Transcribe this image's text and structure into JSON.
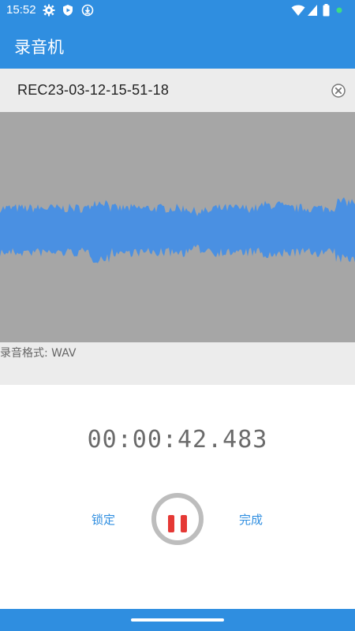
{
  "status_bar": {
    "time": "15:52",
    "left_icons": [
      "settings-icon",
      "shield-play-icon",
      "download-icon"
    ],
    "right_icons": [
      "wifi-icon",
      "cell-signal-icon",
      "battery-icon",
      "dot-icon"
    ],
    "dot_color": "#3ddc84"
  },
  "app_bar": {
    "title": "录音机",
    "color": "#2f8ee0"
  },
  "recording": {
    "filename": "REC23-03-12-15-51-18",
    "format_label": "录音格式: WAV",
    "timer": "00:00:42.483"
  },
  "controls": {
    "lock_label": "锁定",
    "done_label": "完成",
    "pause_color": "#e53935"
  },
  "waveform": {
    "background": "#a6a6a6",
    "color": "#4a90e2"
  }
}
